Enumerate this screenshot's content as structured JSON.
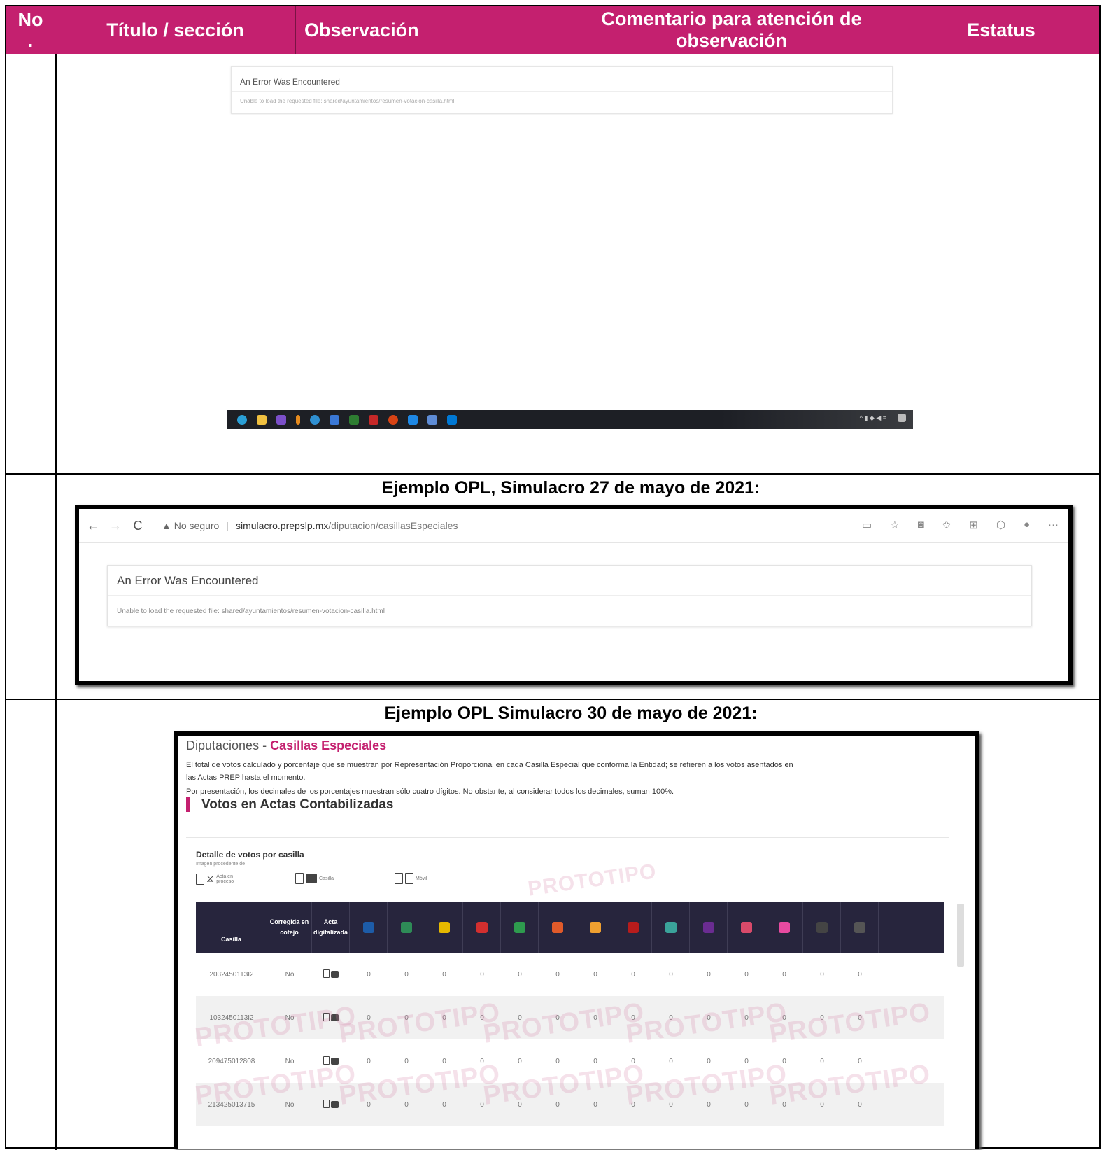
{
  "header": {
    "no": "No\n.",
    "titulo": "Título / sección",
    "observacion": "Observación",
    "comentario": "Comentario para atención de observación",
    "estatus": "Estatus"
  },
  "first_shot": {
    "error_title": "An Error Was Encountered",
    "error_msg": "Unable to load the requested file: shared/ayuntamientos/resumen-votacion-casilla.html"
  },
  "captions": {
    "c1": "Ejemplo OPL, Simulacro 27 de mayo de 2021:",
    "c2": "Ejemplo OPL Simulacro 30 de mayo de 2021:"
  },
  "browser": {
    "back": "←",
    "forward": "→",
    "reload": "C",
    "security": "▲ No seguro",
    "url_host": "simulacro.prepslp.mx",
    "url_path": "/diputacion/casillasEspeciales",
    "error_title": "An Error Was Encountered",
    "error_msg": "Unable to load the requested file: shared/ayuntamientos/resumen-votacion-casilla.html"
  },
  "screen3": {
    "title_prefix": "Diputaciones - ",
    "title_highlight": "Casillas Especiales",
    "para1": "El total de votos calculado y porcentaje que se muestran por Representación Proporcional en cada Casilla Especial que conforma la Entidad; se refieren a los votos asentados en",
    "para1b": "las Actas PREP hasta el momento.",
    "para2": "Por presentación, los decimales de los porcentajes muestran sólo cuatro dígitos. No obstante, al considerar todos los decimales, suman 100%.",
    "heading": "Votos en Actas Contabilizadas",
    "detalle": "Detalle de votos por casilla",
    "imagen": "Imagen procedente de",
    "legend_proceso": "Acta en proceso",
    "legend_casilla": "Casilla",
    "legend_movil": "Móvil",
    "watermark": "PROTOTIPO",
    "columns": [
      "Casilla",
      "Corregida en cotejo",
      "Acta digitalizada"
    ],
    "party_colors": [
      "#1d5ca8",
      "#2e8b57",
      "#e5b800",
      "#d32f2f",
      "#2e9b4e",
      "#e05a2a",
      "#f0a030",
      "#b71c1c",
      "#3aa39a",
      "#6a2c91",
      "#d94a6a",
      "#e74aa0",
      "#444444",
      "#555555"
    ],
    "rows": [
      {
        "casilla": "2032450113I2",
        "corregida": "No",
        "votes": [
          "0",
          "0",
          "0",
          "0",
          "0",
          "0",
          "0",
          "0",
          "0",
          "0",
          "0",
          "0",
          "0",
          "0"
        ]
      },
      {
        "casilla": "1032450113I2",
        "corregida": "No",
        "votes": [
          "0",
          "0",
          "0",
          "0",
          "0",
          "0",
          "0",
          "0",
          "0",
          "0",
          "0",
          "0",
          "0",
          "0"
        ]
      },
      {
        "casilla": "209475012808",
        "corregida": "No",
        "votes": [
          "0",
          "0",
          "0",
          "0",
          "0",
          "0",
          "0",
          "0",
          "0",
          "0",
          "0",
          "0",
          "0",
          "0"
        ]
      },
      {
        "casilla": "213425013715",
        "corregida": "No",
        "votes": [
          "0",
          "0",
          "0",
          "0",
          "0",
          "0",
          "0",
          "0",
          "0",
          "0",
          "0",
          "0",
          "0",
          "0"
        ]
      }
    ]
  }
}
